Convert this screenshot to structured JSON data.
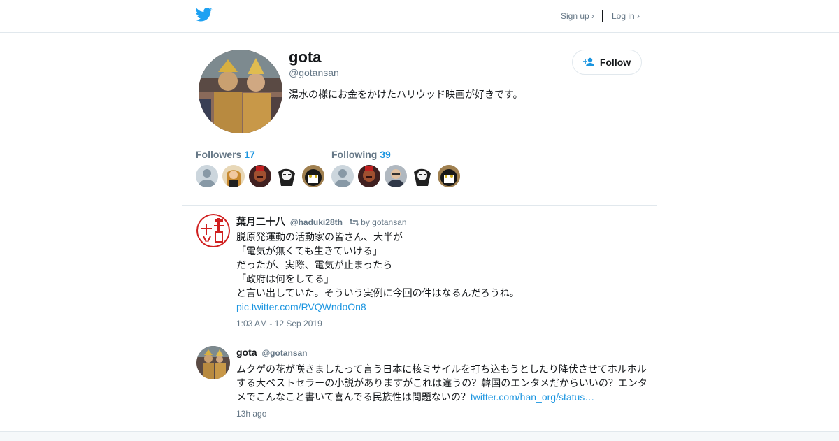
{
  "nav": {
    "signup": "Sign up ›",
    "login": "Log in ›"
  },
  "profile": {
    "name": "gota",
    "handle": "@gotansan",
    "bio": "湯水の様にお金をかけたハリウッド映画が好きです。",
    "follow_label": "Follow"
  },
  "stats": {
    "followers_label": "Followers",
    "followers_count": "17",
    "following_label": "Following",
    "following_count": "39"
  },
  "tweets": [
    {
      "name": "葉月二十八",
      "handle": "@haduki28th",
      "retweet_by": "by gotansan",
      "lines": [
        "脱原発運動の活動家の皆さん、大半が",
        "「電気が無くても生きていける」",
        "だったが、実際、電気が止まったら",
        "「政府は何をしてる」",
        "と言い出していた。そういう実例に今回の件はなるんだろうね。"
      ],
      "link": "pic.twitter.com/RVQWndoOn8",
      "time": "1:03 AM - 12 Sep 2019"
    },
    {
      "name": "gota",
      "handle": "@gotansan",
      "lines": [
        "ムクゲの花が咲きましたって言う日本に核ミサイルを打ち込もうとしたり降伏させてホルホル",
        "する大ベストセラーの小説がありますがこれは違うの？韓国のエンタメだからいいの？エンタ",
        "メでこんなこと書いて喜んでる民族性は問題ないの？"
      ],
      "link": "twitter.com/han_org/status…",
      "time": "13h ago"
    }
  ],
  "colors": {
    "accent": "#1b95e0",
    "twitter_blue": "#1da1f2",
    "muted": "#657786",
    "border": "#e1e8ed"
  }
}
